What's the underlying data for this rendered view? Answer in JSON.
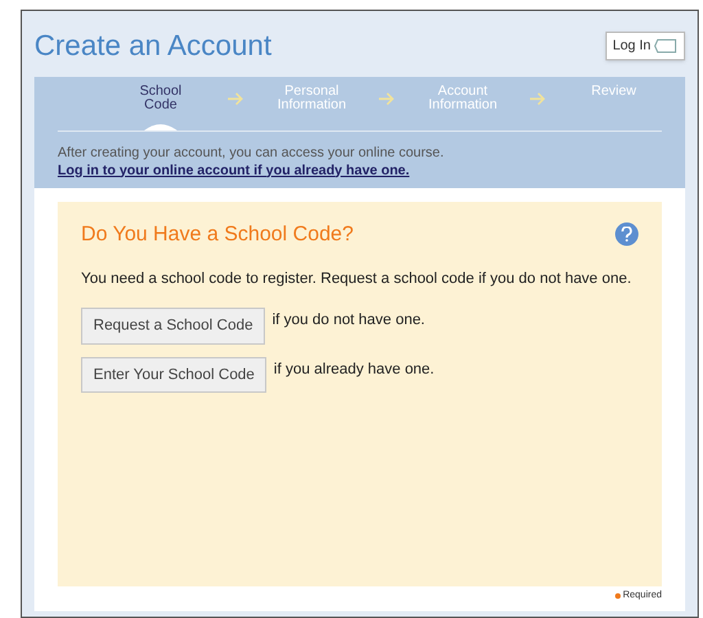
{
  "title": "Create an Account",
  "login_button": "Log In",
  "steps": [
    {
      "label": "School Code",
      "selected": true
    },
    {
      "label": "Personal Information",
      "selected": false
    },
    {
      "label": "Account Information",
      "selected": false
    },
    {
      "label": "Review",
      "selected": false
    }
  ],
  "intro": {
    "text": "After creating your account, you can access your online course.",
    "link": "Log in to your online account if you already have one."
  },
  "panel": {
    "heading": "Do You Have a School Code?",
    "body": "You need a school code to register. Request a school code if you do not have one.",
    "options": [
      {
        "button": "Request a School Code",
        "note": "if you do not have one."
      },
      {
        "button": "Enter Your School Code",
        "note": "if you already have one."
      }
    ]
  },
  "required_note": "Required"
}
